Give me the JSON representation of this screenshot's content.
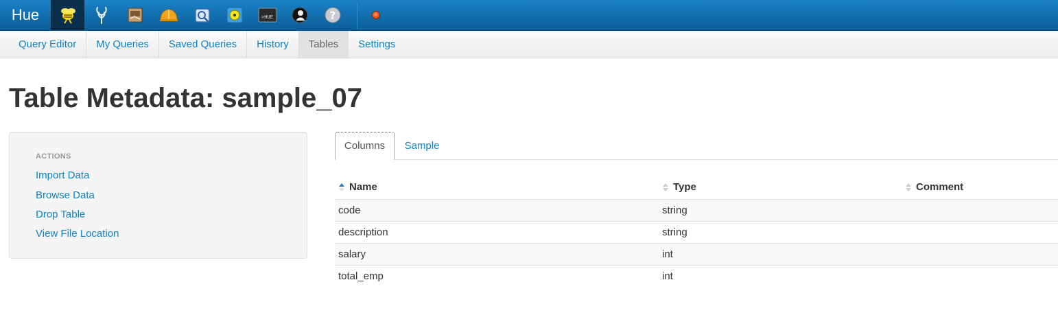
{
  "topbar": {
    "brand": "Hue",
    "apps": [
      {
        "icon": "beeswax-icon",
        "active": true
      },
      {
        "icon": "oozie-icon",
        "active": false
      },
      {
        "icon": "file-browser-icon",
        "active": false
      },
      {
        "icon": "job-designer-icon",
        "active": false
      },
      {
        "icon": "job-browser-icon",
        "active": false
      },
      {
        "icon": "help-circle-icon",
        "active": false
      },
      {
        "icon": "shell-icon",
        "active": false
      },
      {
        "icon": "user-admin-icon",
        "active": false
      },
      {
        "icon": "question-icon",
        "active": false
      }
    ],
    "status_icon": "status-dot-icon"
  },
  "subnav": {
    "items": [
      {
        "label": "Query Editor",
        "active": false
      },
      {
        "label": "My Queries",
        "active": false
      },
      {
        "label": "Saved Queries",
        "active": false
      },
      {
        "label": "History",
        "active": false
      },
      {
        "label": "Tables",
        "active": true
      },
      {
        "label": "Settings",
        "active": false
      }
    ]
  },
  "page": {
    "title": "Table Metadata: sample_07"
  },
  "sidebar": {
    "header": "ACTIONS",
    "links": [
      "Import Data",
      "Browse Data",
      "Drop Table",
      "View File Location"
    ]
  },
  "tabs": {
    "items": [
      "Columns",
      "Sample"
    ],
    "active_index": 0
  },
  "table": {
    "columns": [
      "Name",
      "Type",
      "Comment"
    ],
    "rows": [
      {
        "name": "code",
        "type": "string",
        "comment": ""
      },
      {
        "name": "description",
        "type": "string",
        "comment": ""
      },
      {
        "name": "salary",
        "type": "int",
        "comment": ""
      },
      {
        "name": "total_emp",
        "type": "int",
        "comment": ""
      }
    ]
  },
  "colors": {
    "topbar": "#0f6eaf",
    "link": "#0c82c7",
    "text": "#333333"
  }
}
